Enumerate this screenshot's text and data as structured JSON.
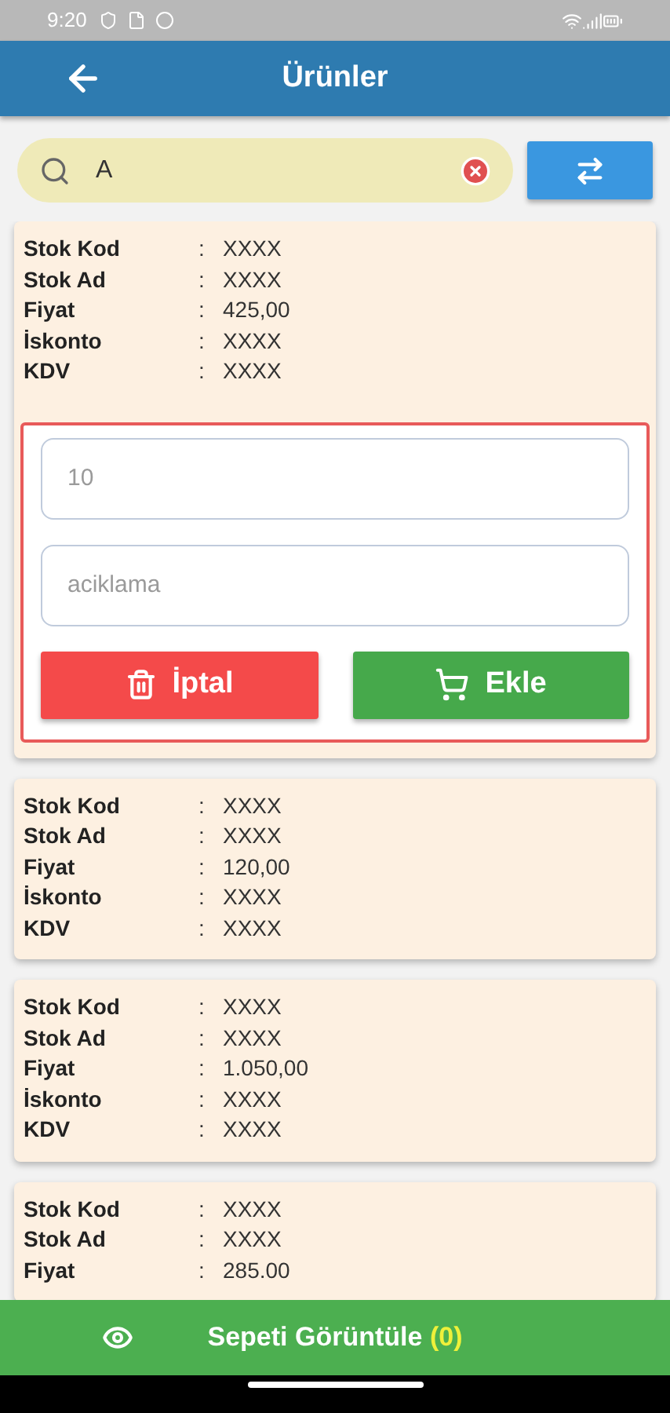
{
  "status_bar": {
    "time": "9:20"
  },
  "app_bar": {
    "title": "Ürünler"
  },
  "search": {
    "value": "A"
  },
  "products": [
    {
      "fields": [
        {
          "label": "Stok Kod",
          "colon": ":",
          "value": "XXXX"
        },
        {
          "label": "Stok Ad",
          "colon": ":",
          "value": "XXXX"
        },
        {
          "label": "Fiyat",
          "colon": ":",
          "value": "425,00"
        },
        {
          "label": "İskonto",
          "colon": ":",
          "value": "XXXX"
        },
        {
          "label": "KDV",
          "colon": ":",
          "value": "XXXX"
        }
      ],
      "editor": {
        "quantity_placeholder": "10",
        "note_placeholder": "aciklama",
        "cancel": "İptal",
        "add": "Ekle"
      }
    },
    {
      "fields": [
        {
          "label": "Stok Kod",
          "colon": ":",
          "value": "XXXX"
        },
        {
          "label": "Stok Ad",
          "colon": ":",
          "value": "XXXX"
        },
        {
          "label": "Fiyat",
          "colon": ":",
          "value": "120,00"
        },
        {
          "label": "İskonto",
          "colon": ":",
          "value": "XXXX"
        },
        {
          "label": "KDV",
          "colon": ":",
          "value": "XXXX"
        }
      ]
    },
    {
      "fields": [
        {
          "label": "Stok Kod",
          "colon": ":",
          "value": "XXXX"
        },
        {
          "label": "Stok Ad",
          "colon": ":",
          "value": "XXXX"
        },
        {
          "label": "Fiyat",
          "colon": ":",
          "value": "1.050,00"
        },
        {
          "label": "İskonto",
          "colon": ":",
          "value": "XXXX"
        },
        {
          "label": "KDV",
          "colon": ":",
          "value": "XXXX"
        }
      ]
    },
    {
      "fields": [
        {
          "label": "Stok Kod",
          "colon": ":",
          "value": "XXXX"
        },
        {
          "label": "Stok Ad",
          "colon": ":",
          "value": "XXXX"
        },
        {
          "label": "Fiyat",
          "colon": ":",
          "value": "285.00"
        }
      ]
    }
  ],
  "cart_button": {
    "label": "Sepeti Görüntüle",
    "count": "(0)"
  }
}
